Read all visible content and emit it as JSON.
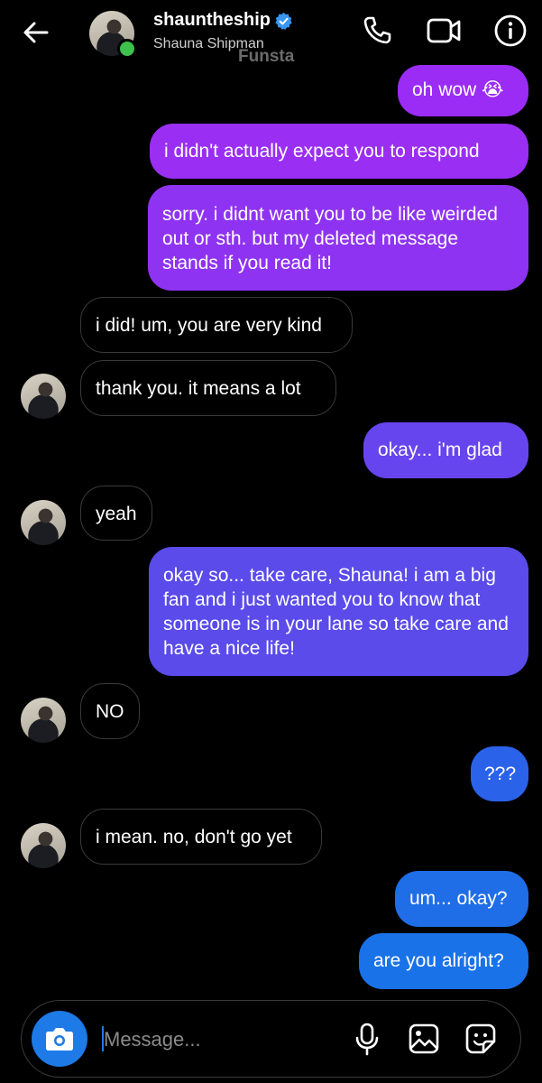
{
  "header": {
    "username": "shauntheship",
    "full_name": "Shauna Shipman",
    "watermark": "Funsta",
    "icons": [
      "back-arrow-icon",
      "verified-badge-icon",
      "phone-icon",
      "video-camera-icon",
      "info-icon"
    ]
  },
  "messages": [
    {
      "side": "sent",
      "text": "oh wow 😭"
    },
    {
      "side": "sent",
      "text": "i didn't actually expect you to respond"
    },
    {
      "side": "sent",
      "text": "sorry. i didnt want you to be like weirded out or sth. but my deleted message stands if you read it!"
    },
    {
      "side": "received",
      "text": "i did! um, you are very kind"
    },
    {
      "side": "received",
      "text": "thank you. it means a lot"
    },
    {
      "side": "sent",
      "text": "okay... i'm glad"
    },
    {
      "side": "received",
      "text": "yeah"
    },
    {
      "side": "sent",
      "text": "okay so... take care, Shauna! i am a big fan and i just wanted you to know that someone is in your lane so take care and have a nice life!"
    },
    {
      "side": "received",
      "text": "NO"
    },
    {
      "side": "sent",
      "text": "???"
    },
    {
      "side": "received",
      "text": "i mean. no, don't go yet"
    },
    {
      "side": "sent",
      "text": "um... okay?"
    },
    {
      "side": "sent",
      "text": "are you alright?"
    }
  ],
  "composer": {
    "placeholder": "Message...",
    "icons": [
      "camera-icon",
      "microphone-icon",
      "gallery-icon",
      "sticker-icon"
    ]
  },
  "colors": {
    "background": "#000000",
    "sent_gradient": [
      "#8a2be2",
      "#5b4ee6",
      "#1f6ee8"
    ],
    "received_border": "#3a3a3a",
    "accent_blue": "#1d7ae6",
    "online_green": "#3cc24d"
  }
}
